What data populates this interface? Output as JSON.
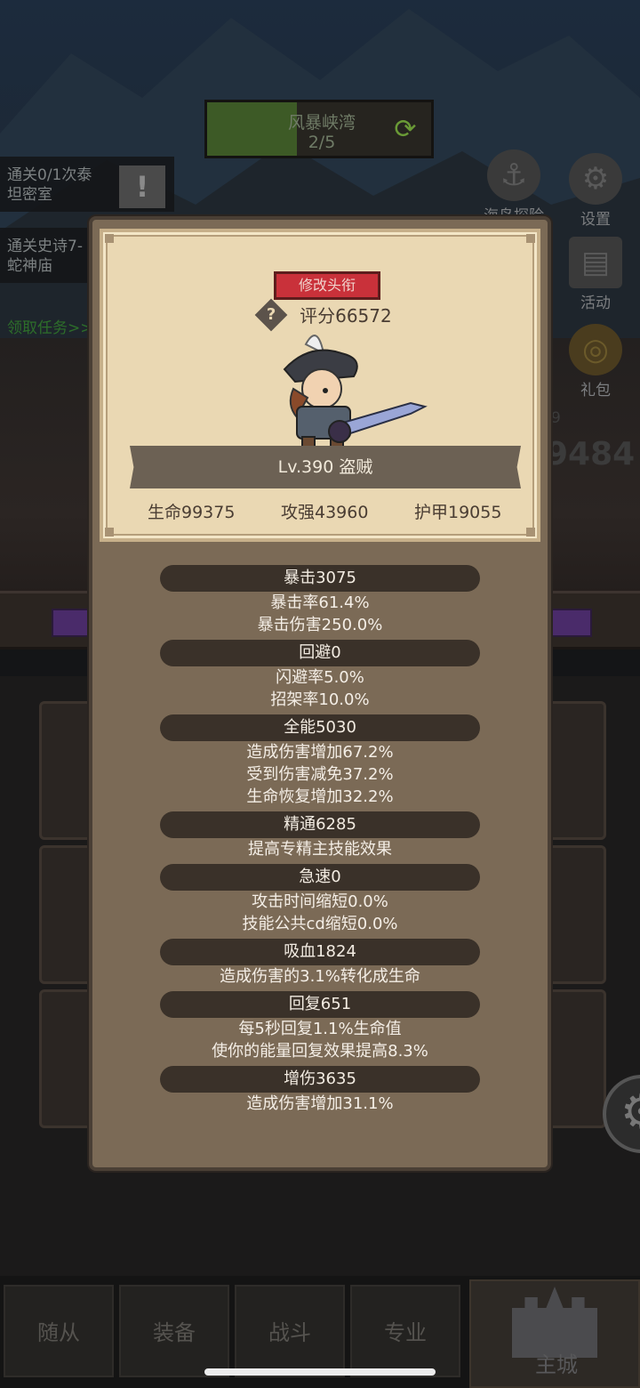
{
  "hud": {
    "stage_name": "风暴峡湾",
    "stage_progress": "2/5",
    "stage_progress_fraction": 0.4,
    "quests": [
      {
        "line1": "通关0/1次泰",
        "line2": "坦密室"
      },
      {
        "line1": "通关史诗7-",
        "line2": "蛇神庙"
      }
    ],
    "quest_link": "领取任务>>",
    "buttons": {
      "island": "海岛探险",
      "settings": "设置",
      "activity": "活动",
      "gift": "礼包"
    },
    "bg_number": "9484",
    "bg_small": "9"
  },
  "dialog": {
    "title_button": "修改头衔",
    "help_symbol": "?",
    "score": "评分66572",
    "level_class": "Lv.390 盗贼",
    "hp": "生命99375",
    "attack": "攻强43960",
    "armor": "护甲19055",
    "attributes": [
      {
        "header": "暴击3075",
        "lines": [
          "暴击率61.4%",
          "暴击伤害250.0%"
        ]
      },
      {
        "header": "回避0",
        "lines": [
          "闪避率5.0%",
          "招架率10.0%"
        ]
      },
      {
        "header": "全能5030",
        "lines": [
          "造成伤害增加67.2%",
          "受到伤害减免37.2%",
          "生命恢复增加32.2%"
        ]
      },
      {
        "header": "精通6285",
        "lines": [
          "提高专精主技能效果"
        ]
      },
      {
        "header": "急速0",
        "lines": [
          "攻击时间缩短0.0%",
          "技能公共cd缩短0.0%"
        ]
      },
      {
        "header": "吸血1824",
        "lines": [
          "造成伤害的3.1%转化成生命"
        ]
      },
      {
        "header": "回复651",
        "lines": [
          "每5秒回复1.1%生命值",
          "使你的能量回复效果提高8.3%"
        ]
      },
      {
        "header": "增伤3635",
        "lines": [
          "造成伤害增加31.1%"
        ]
      }
    ]
  },
  "nav": {
    "items": [
      "随从",
      "装备",
      "战斗",
      "专业"
    ],
    "castle": "主城"
  },
  "colors": {
    "panel": "#7b6a56",
    "card": "#ead8b3",
    "title_button": "#c9313a",
    "attr_header": "#3a3129"
  }
}
